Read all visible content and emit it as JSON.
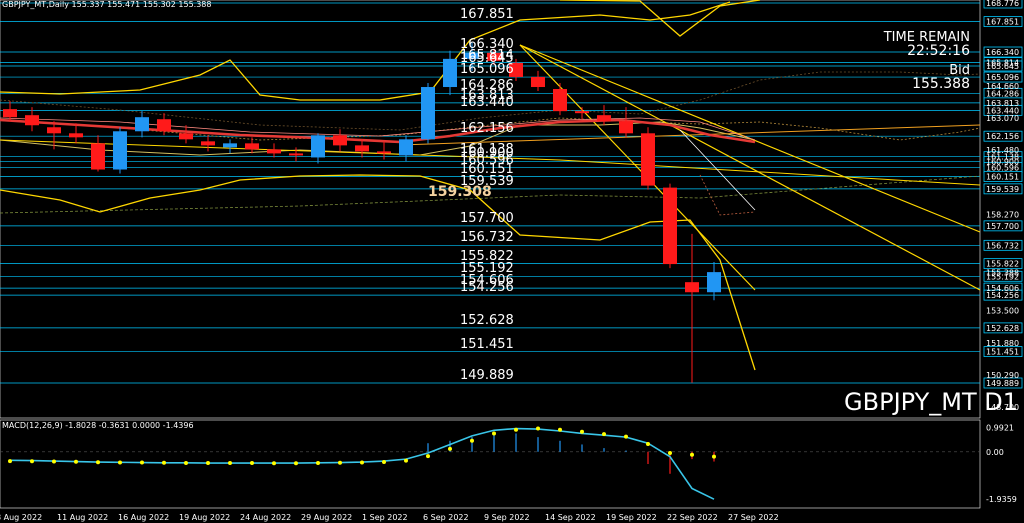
{
  "header": {
    "symbol_info": "GBPJPY_MT,Daily  155.337 155.471 155.302 155.388",
    "macd_info": "MACD(12,26,9) -1.8028 -0.3631 0.0000 -1.4396",
    "symbol_label": "GBPJPY_MT D1",
    "time_remain_label": "TIME REMAIN",
    "time_remain_value": "22:52:16",
    "bid_label": "Bid",
    "bid_value": "155.388"
  },
  "colors": {
    "bull": "#2196f3",
    "bear": "#ff1a1a",
    "level_line": "#00c8ff",
    "band": "#ffd700",
    "ma": "#e53935",
    "macd_signal": "#39c5e8",
    "macd_dots": "#ffff00"
  },
  "chart_data": {
    "type": "candlestick",
    "price_axis": {
      "ylim": [
        148.0,
        170.0
      ],
      "ticks": [
        "168.776",
        "167.851",
        "166.340",
        "165.814",
        "165.645",
        "165.096",
        "164.660",
        "164.286",
        "163.813",
        "163.440",
        "163.070",
        "162.156",
        "161.480",
        "161.138",
        "160.900",
        "160.596",
        "160.151",
        "159.539",
        "158.270",
        "157.700",
        "156.732",
        "155.822",
        "155.388",
        "155.192",
        "154.606",
        "154.256",
        "153.500",
        "152.628",
        "151.880",
        "151.451",
        "150.290",
        "149.889",
        "148.700"
      ]
    },
    "levels": [
      {
        "label": "168.776",
        "value": 168.776
      },
      {
        "label": "167.851",
        "value": 167.851
      },
      {
        "label": "166.340",
        "value": 166.34
      },
      {
        "label": "165.814",
        "value": 165.814
      },
      {
        "label": "165.645",
        "value": 165.645
      },
      {
        "label": "165.096",
        "value": 165.096
      },
      {
        "label": "164.286",
        "value": 164.286
      },
      {
        "label": "163.813",
        "value": 163.813
      },
      {
        "label": "163.440",
        "value": 163.44
      },
      {
        "label": "162.156",
        "value": 162.156
      },
      {
        "label": "161.138",
        "value": 161.138
      },
      {
        "label": "160.900",
        "value": 160.9
      },
      {
        "label": "160.596",
        "value": 160.596
      },
      {
        "label": "160.151",
        "value": 160.151
      },
      {
        "label": "159.539",
        "value": 159.539
      },
      {
        "label": "157.700",
        "value": 157.7
      },
      {
        "label": "156.732",
        "value": 156.732
      },
      {
        "label": "155.822",
        "value": 155.822
      },
      {
        "label": "155.192",
        "value": 155.192
      },
      {
        "label": "154.606",
        "value": 154.606
      },
      {
        "label": "154.256",
        "value": 154.256
      },
      {
        "label": "152.628",
        "value": 152.628
      },
      {
        "label": "151.451",
        "value": 151.451
      },
      {
        "label": "149.889",
        "value": 149.889
      }
    ],
    "highlight_level": {
      "label": "159.308",
      "value": 159.308
    },
    "x_labels": [
      "8 Aug 2022",
      "11 Aug 2022",
      "16 Aug 2022",
      "19 Aug 2022",
      "24 Aug 2022",
      "29 Aug 2022",
      "1 Sep 2022",
      "6 Sep 2022",
      "9 Sep 2022",
      "14 Sep 2022",
      "19 Sep 2022",
      "22 Sep 2022",
      "27 Sep 2022"
    ],
    "candles": [
      {
        "o": 163.5,
        "h": 163.9,
        "l": 162.9,
        "c": 163.1
      },
      {
        "o": 163.2,
        "h": 163.6,
        "l": 162.4,
        "c": 162.7
      },
      {
        "o": 162.6,
        "h": 162.9,
        "l": 161.5,
        "c": 162.3
      },
      {
        "o": 162.3,
        "h": 162.8,
        "l": 161.8,
        "c": 162.1
      },
      {
        "o": 161.8,
        "h": 162.2,
        "l": 160.4,
        "c": 160.5
      },
      {
        "o": 160.5,
        "h": 162.6,
        "l": 160.3,
        "c": 162.4
      },
      {
        "o": 162.4,
        "h": 163.4,
        "l": 162.1,
        "c": 163.1
      },
      {
        "o": 163.0,
        "h": 163.3,
        "l": 162.2,
        "c": 162.4
      },
      {
        "o": 162.3,
        "h": 162.7,
        "l": 161.8,
        "c": 162.0
      },
      {
        "o": 161.9,
        "h": 162.2,
        "l": 161.4,
        "c": 161.7
      },
      {
        "o": 161.6,
        "h": 162.0,
        "l": 161.3,
        "c": 161.8
      },
      {
        "o": 161.8,
        "h": 162.1,
        "l": 161.3,
        "c": 161.5
      },
      {
        "o": 161.5,
        "h": 161.8,
        "l": 161.1,
        "c": 161.3
      },
      {
        "o": 161.3,
        "h": 161.6,
        "l": 160.9,
        "c": 161.2
      },
      {
        "o": 161.1,
        "h": 162.3,
        "l": 160.8,
        "c": 162.2
      },
      {
        "o": 162.2,
        "h": 162.5,
        "l": 161.4,
        "c": 161.7
      },
      {
        "o": 161.7,
        "h": 162.0,
        "l": 161.1,
        "c": 161.4
      },
      {
        "o": 161.4,
        "h": 161.9,
        "l": 161.0,
        "c": 161.3
      },
      {
        "o": 161.2,
        "h": 162.2,
        "l": 160.9,
        "c": 162.0
      },
      {
        "o": 162.0,
        "h": 164.8,
        "l": 161.8,
        "c": 164.6
      },
      {
        "o": 164.6,
        "h": 166.4,
        "l": 164.2,
        "c": 166.0
      },
      {
        "o": 166.0,
        "h": 166.8,
        "l": 165.4,
        "c": 166.3
      },
      {
        "o": 166.3,
        "h": 166.5,
        "l": 165.7,
        "c": 165.9
      },
      {
        "o": 165.8,
        "h": 166.0,
        "l": 164.9,
        "c": 165.1
      },
      {
        "o": 165.1,
        "h": 165.4,
        "l": 164.4,
        "c": 164.6
      },
      {
        "o": 164.5,
        "h": 164.8,
        "l": 163.2,
        "c": 163.4
      },
      {
        "o": 163.4,
        "h": 163.6,
        "l": 163.0,
        "c": 163.3
      },
      {
        "o": 163.2,
        "h": 163.7,
        "l": 162.7,
        "c": 162.9
      },
      {
        "o": 162.9,
        "h": 163.6,
        "l": 162.1,
        "c": 162.3
      },
      {
        "o": 162.3,
        "h": 162.6,
        "l": 159.5,
        "c": 159.7
      },
      {
        "o": 159.6,
        "h": 159.8,
        "l": 155.6,
        "c": 155.8
      },
      {
        "o": 154.9,
        "h": 157.3,
        "l": 149.9,
        "c": 154.4
      },
      {
        "o": 154.4,
        "h": 155.9,
        "l": 154.0,
        "c": 155.4
      }
    ],
    "macd": {
      "ylim": [
        -2.3,
        1.3
      ],
      "ticks": [
        "0.9921",
        "0.00",
        "-1.9359"
      ],
      "histogram": [
        0.0,
        0.0,
        0.0,
        0.0,
        0.0,
        0.0,
        0.0,
        0.0,
        0.0,
        0.0,
        0.0,
        0.0,
        0.0,
        0.0,
        0.0,
        0.0,
        0.0,
        0.0,
        0.0,
        0.35,
        0.45,
        0.6,
        0.8,
        0.75,
        0.6,
        0.45,
        0.3,
        0.15,
        0.05,
        -0.5,
        -0.9,
        -0.3,
        -0.4
      ],
      "signal": [
        -0.35,
        -0.36,
        -0.38,
        -0.4,
        -0.42,
        -0.43,
        -0.44,
        -0.45,
        -0.45,
        -0.46,
        -0.46,
        -0.46,
        -0.46,
        -0.46,
        -0.45,
        -0.44,
        -0.42,
        -0.38,
        -0.3,
        -0.05,
        0.3,
        0.65,
        0.88,
        0.95,
        0.93,
        0.85,
        0.75,
        0.68,
        0.6,
        0.35,
        -0.2,
        -1.5,
        -1.94
      ],
      "dots": [
        -0.38,
        -0.39,
        -0.4,
        -0.41,
        -0.43,
        -0.44,
        -0.44,
        -0.45,
        -0.46,
        -0.46,
        -0.46,
        -0.46,
        -0.47,
        -0.47,
        -0.46,
        -0.45,
        -0.44,
        -0.42,
        -0.36,
        -0.18,
        0.12,
        0.45,
        0.75,
        0.9,
        0.95,
        0.9,
        0.82,
        0.72,
        0.62,
        0.32,
        -0.05,
        -0.12,
        -0.2
      ]
    }
  }
}
